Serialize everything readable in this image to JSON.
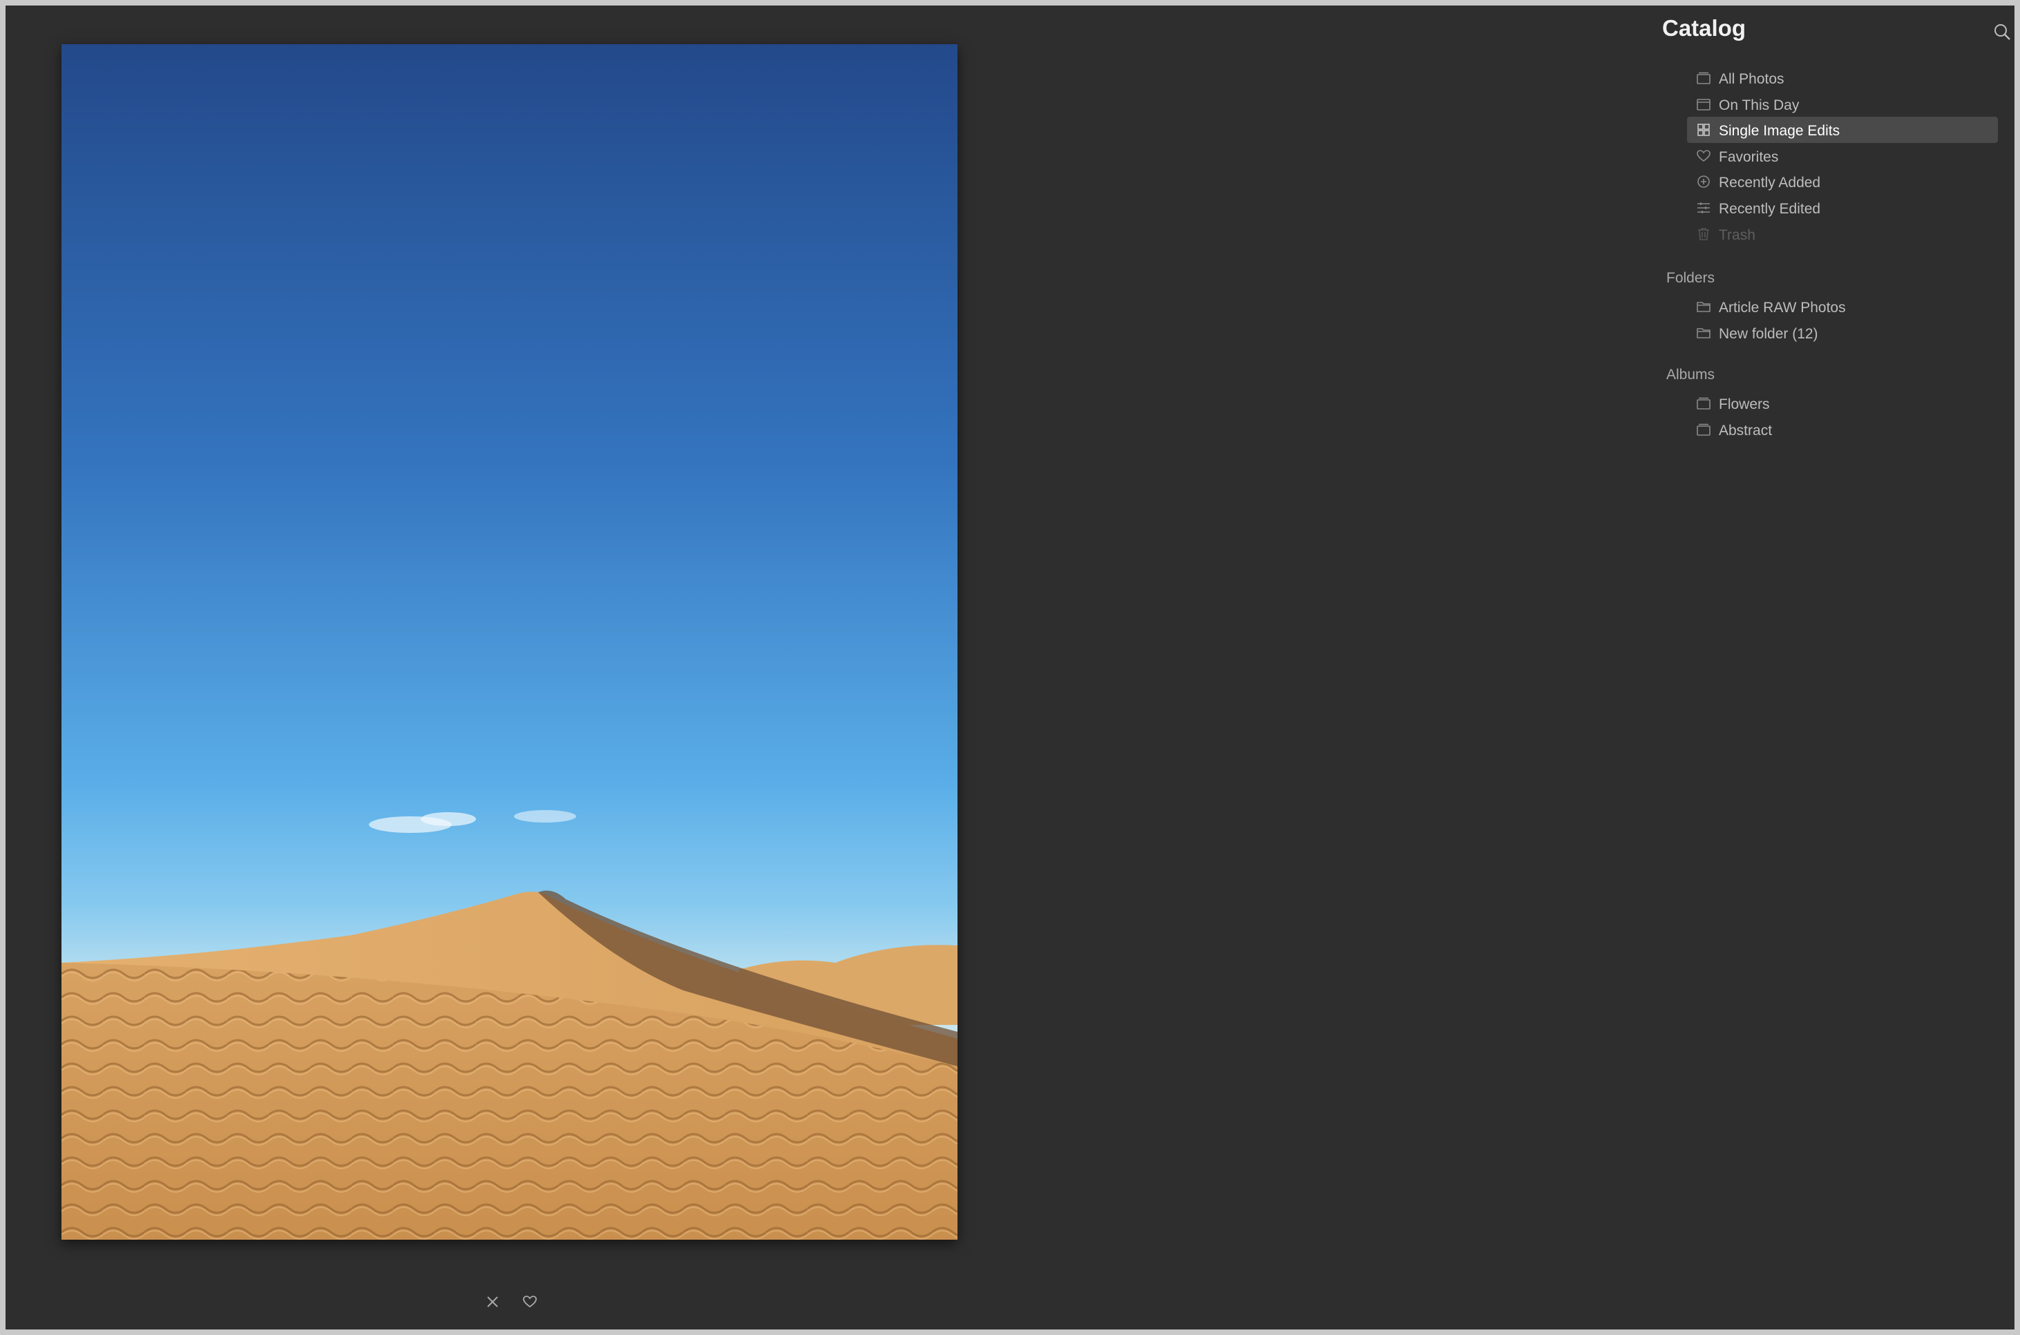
{
  "sidebar": {
    "title": "Catalog",
    "catalog_items": [
      {
        "label": "All Photos",
        "icon": "photos-stack-icon"
      },
      {
        "label": "On This Day",
        "icon": "calendar-icon"
      },
      {
        "label": "Single Image Edits",
        "icon": "grid-icon",
        "selected": true
      },
      {
        "label": "Favorites",
        "icon": "heart-icon"
      },
      {
        "label": "Recently Added",
        "icon": "plus-circle-icon"
      },
      {
        "label": "Recently Edited",
        "icon": "sliders-icon"
      },
      {
        "label": "Trash",
        "icon": "trash-icon",
        "disabled": true
      }
    ],
    "folders_heading": "Folders",
    "folders": [
      {
        "label": "Article RAW Photos",
        "icon": "folder-icon"
      },
      {
        "label": "New folder (12)",
        "icon": "folder-icon"
      }
    ],
    "albums_heading": "Albums",
    "albums": [
      {
        "label": "Flowers",
        "icon": "album-icon"
      },
      {
        "label": "Abstract",
        "icon": "album-icon"
      }
    ]
  },
  "viewer": {
    "photo_subject": "desert sand dunes under blue sky",
    "reject_icon": "close-icon",
    "favorite_icon": "heart-icon"
  },
  "colors": {
    "background": "#2e2e2e",
    "selection": "#4a4a4a"
  }
}
